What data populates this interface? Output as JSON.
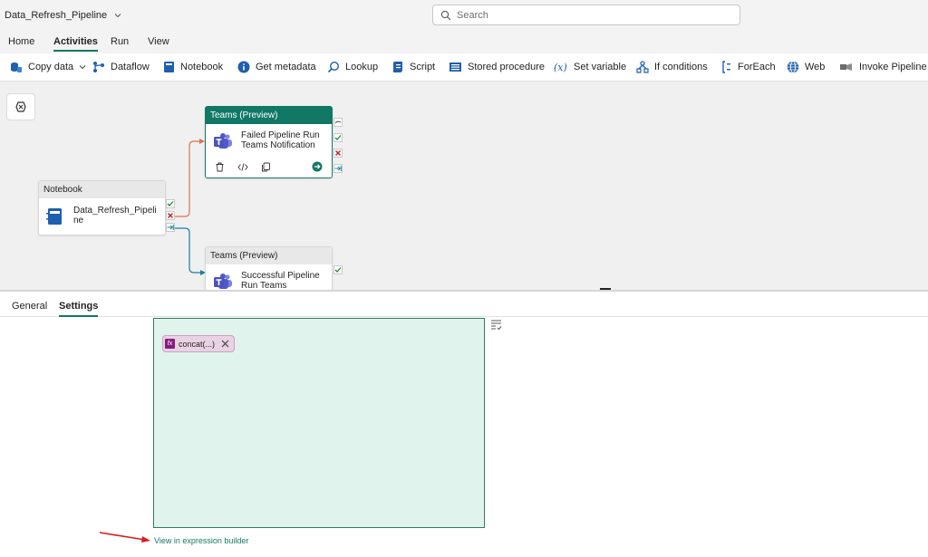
{
  "app": {
    "title": "Data_Refresh_Pipeline",
    "search_placeholder": "Search"
  },
  "tabs": [
    {
      "label": "Home",
      "active": false
    },
    {
      "label": "Activities",
      "active": true
    },
    {
      "label": "Run",
      "active": false
    },
    {
      "label": "View",
      "active": false
    }
  ],
  "toolbar": [
    {
      "label": "Copy data",
      "icon": "copy-data-icon",
      "dropdown": true
    },
    {
      "label": "Dataflow",
      "icon": "dataflow-icon"
    },
    {
      "label": "Notebook",
      "icon": "notebook-icon"
    },
    {
      "label": "Get metadata",
      "icon": "info-icon"
    },
    {
      "label": "Lookup",
      "icon": "lookup-icon"
    },
    {
      "label": "Script",
      "icon": "script-icon"
    },
    {
      "label": "Stored procedure",
      "icon": "stored-procedure-icon"
    },
    {
      "label": "Set variable",
      "icon": "variable-icon"
    },
    {
      "label": "If conditions",
      "icon": "if-conditions-icon"
    },
    {
      "label": "ForEach",
      "icon": "foreach-icon"
    },
    {
      "label": "Web",
      "icon": "web-icon"
    },
    {
      "label": "Invoke Pipeline (L",
      "icon": "invoke-pipeline-icon"
    }
  ],
  "canvas": {
    "nodes": {
      "notebook": {
        "type": "Notebook",
        "name": "Data_Refresh_Pipeli\nne"
      },
      "teams_failed": {
        "type": "Teams (Preview)",
        "name_line1": "Failed Pipeline Run",
        "name_line2": "Teams Notification"
      },
      "teams_success": {
        "type": "Teams (Preview)",
        "name_line1": "Successful Pipeline",
        "name_line2": "Run Teams"
      }
    },
    "colors": {
      "brand": "#117865",
      "fail_connector": "#e0714f",
      "success_connector": "#1a7fa0"
    }
  },
  "panel": {
    "tabs": [
      {
        "label": "General",
        "active": false
      },
      {
        "label": "Settings",
        "active": true
      }
    ],
    "expression_chip": "concat(...)",
    "fx_label": "fx",
    "expression_builder_link": "View in expression builder"
  }
}
